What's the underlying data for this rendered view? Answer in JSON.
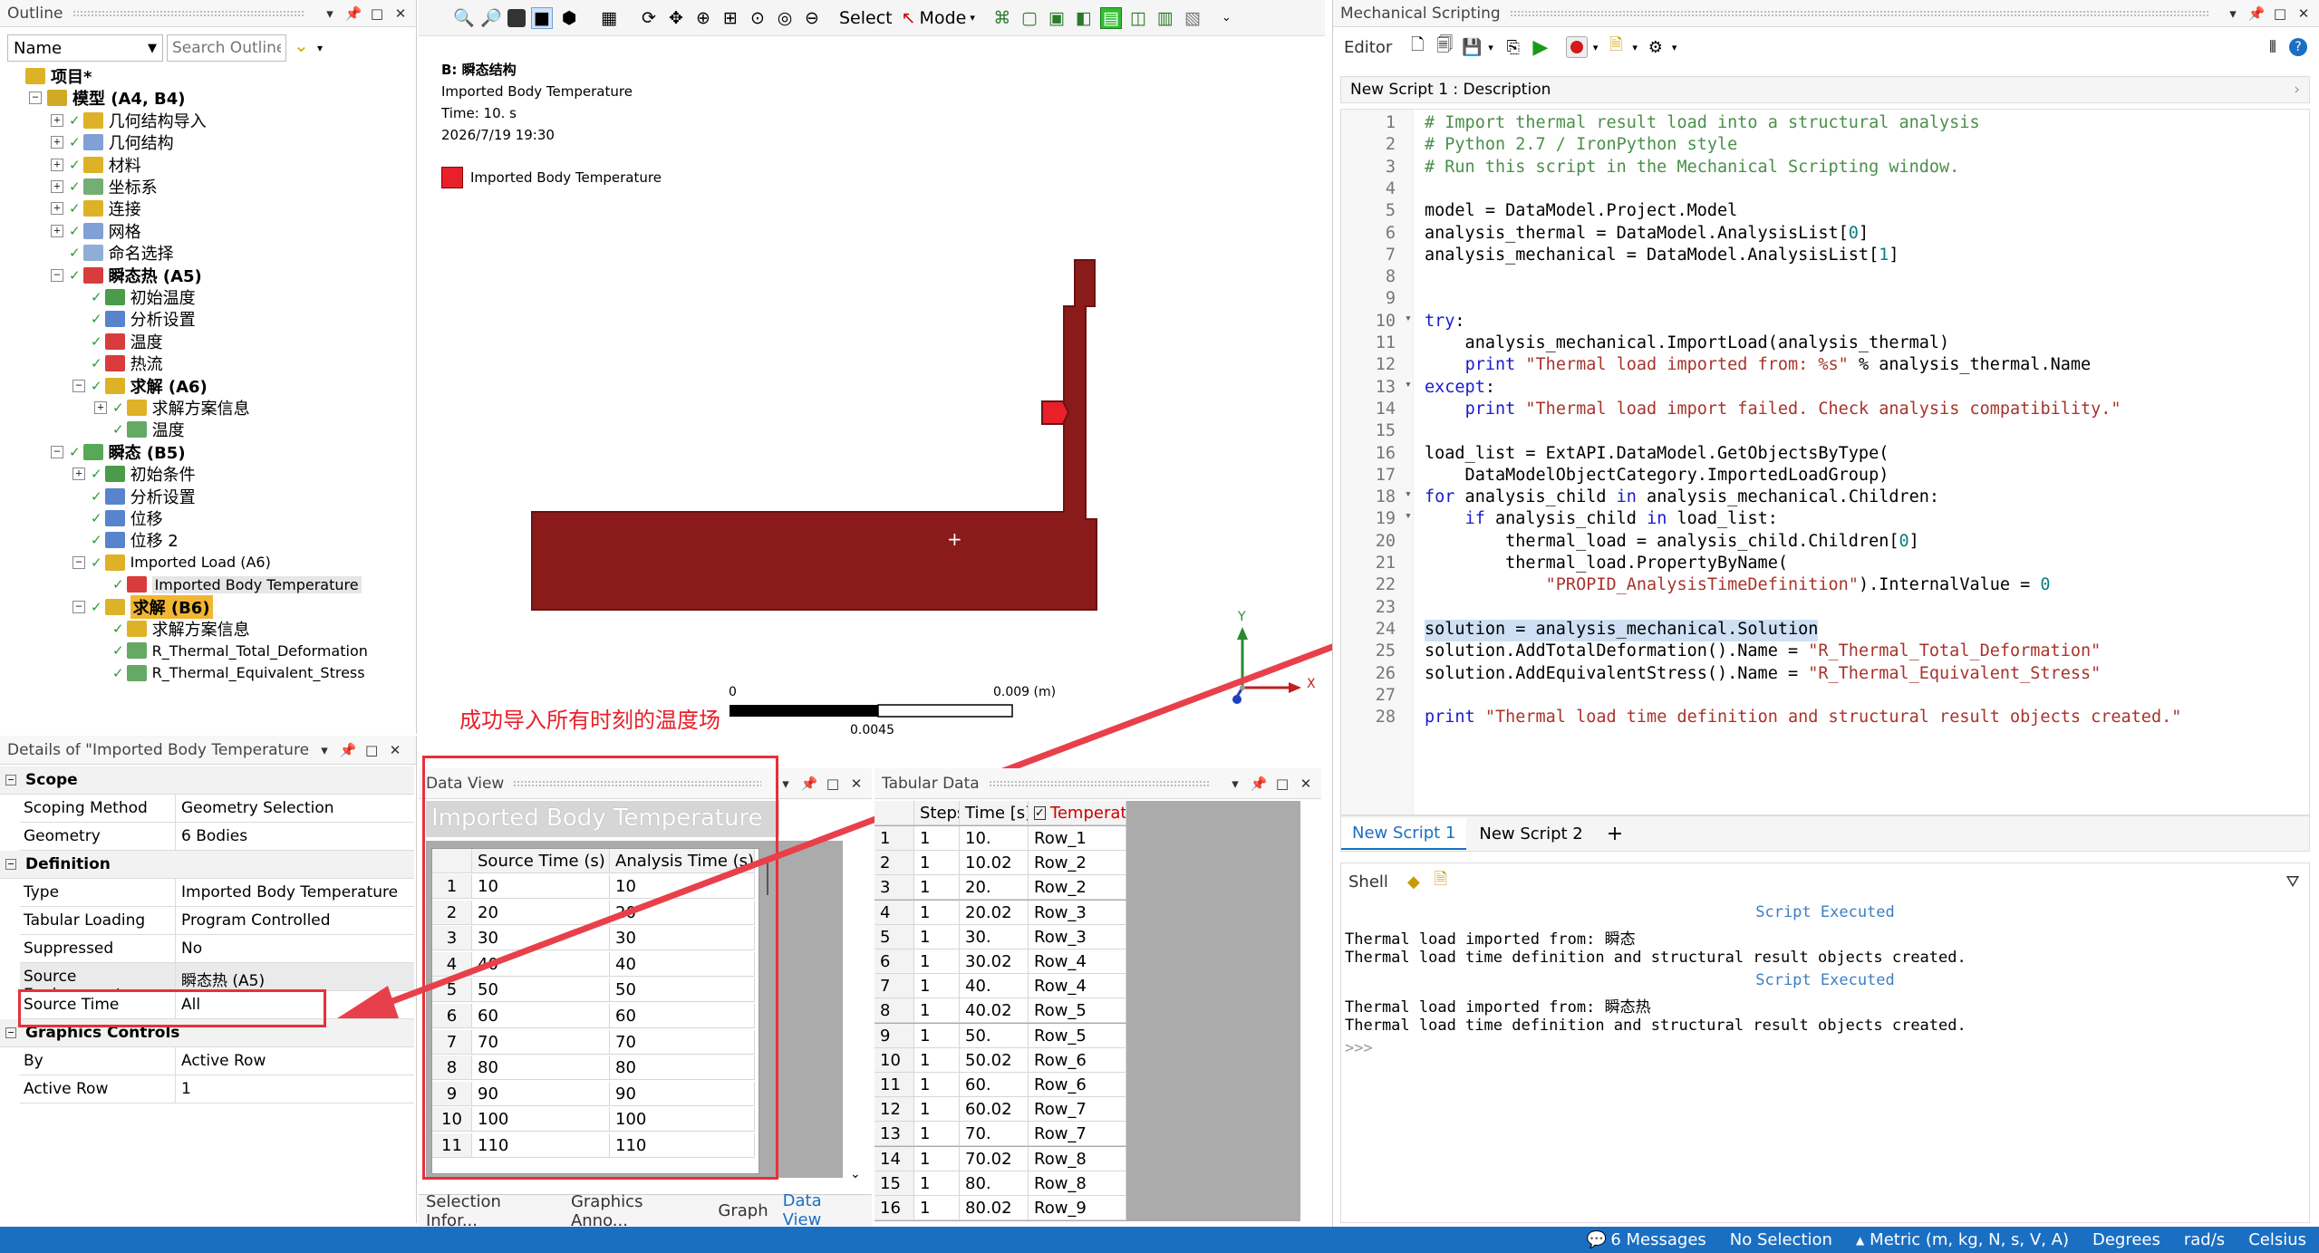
{
  "outline": {
    "title": "Outline",
    "filter_value": "Name",
    "search_placeholder": "Search Outline",
    "tree": [
      {
        "label": "项目*",
        "level": 0,
        "bold": true,
        "exp": "",
        "icon": "project"
      },
      {
        "label": "模型 (A4, B4)",
        "level": 1,
        "bold": true,
        "exp": "−",
        "icon": "model"
      },
      {
        "label": "几何结构导入",
        "level": 2,
        "exp": "+",
        "icon": "folder"
      },
      {
        "label": "几何结构",
        "level": 2,
        "exp": "+",
        "icon": "geom"
      },
      {
        "label": "材料",
        "level": 2,
        "exp": "+",
        "icon": "folder"
      },
      {
        "label": "坐标系",
        "level": 2,
        "exp": "+",
        "icon": "coord"
      },
      {
        "label": "连接",
        "level": 2,
        "exp": "+",
        "icon": "folder"
      },
      {
        "label": "网格",
        "level": 2,
        "exp": "+",
        "icon": "mesh"
      },
      {
        "label": "命名选择",
        "level": 2,
        "exp": "",
        "icon": "named"
      },
      {
        "label": "瞬态热 (A5)",
        "level": 2,
        "bold": true,
        "exp": "−",
        "icon": "thermal"
      },
      {
        "label": "初始温度",
        "level": 3,
        "exp": "",
        "icon": "init"
      },
      {
        "label": "分析设置",
        "level": 3,
        "exp": "",
        "icon": "settings"
      },
      {
        "label": "温度",
        "level": 3,
        "exp": "",
        "icon": "temp"
      },
      {
        "label": "热流",
        "level": 3,
        "exp": "",
        "icon": "flux"
      },
      {
        "label": "求解 (A6)",
        "level": 3,
        "bold": true,
        "exp": "−",
        "icon": "solution"
      },
      {
        "label": "求解方案信息",
        "level": 4,
        "exp": "+",
        "icon": "info"
      },
      {
        "label": "温度",
        "level": 4,
        "exp": "",
        "icon": "result"
      },
      {
        "label": "瞬态 (B5)",
        "level": 2,
        "bold": true,
        "exp": "−",
        "icon": "structural"
      },
      {
        "label": "初始条件",
        "level": 3,
        "exp": "+",
        "icon": "init"
      },
      {
        "label": "分析设置",
        "level": 3,
        "exp": "",
        "icon": "settings"
      },
      {
        "label": "位移",
        "level": 3,
        "exp": "",
        "icon": "disp"
      },
      {
        "label": "位移 2",
        "level": 3,
        "exp": "",
        "icon": "disp"
      },
      {
        "label": "Imported Load (A6)",
        "level": 3,
        "exp": "−",
        "icon": "folder"
      },
      {
        "label": "Imported Body Temperature",
        "level": 4,
        "exp": "",
        "icon": "ibt",
        "selected": true
      },
      {
        "label": "求解 (B6)",
        "level": 3,
        "bold": true,
        "exp": "−",
        "icon": "solution",
        "highlight": true
      },
      {
        "label": "求解方案信息",
        "level": 4,
        "exp": "",
        "icon": "info"
      },
      {
        "label": "R_Thermal_Total_Deformation",
        "level": 4,
        "exp": "",
        "icon": "result"
      },
      {
        "label": "R_Thermal_Equivalent_Stress",
        "level": 4,
        "exp": "",
        "icon": "result"
      }
    ]
  },
  "details": {
    "title": "Details of \"Imported Body Temperature",
    "sections": [
      {
        "name": "Scope",
        "rows": [
          [
            "Scoping Method",
            "Geometry Selection"
          ],
          [
            "Geometry",
            "6 Bodies"
          ]
        ]
      },
      {
        "name": "Definition",
        "rows": [
          [
            "Type",
            "Imported Body Temperature"
          ],
          [
            "Tabular Loading",
            "Program Controlled"
          ],
          [
            "Suppressed",
            "No"
          ],
          [
            "Source Environment",
            "瞬态热 (A5)"
          ],
          [
            "Source Time",
            "All"
          ]
        ]
      },
      {
        "name": "Graphics Controls",
        "rows": [
          [
            "By",
            "Active Row"
          ],
          [
            "Active Row",
            "1"
          ]
        ]
      }
    ]
  },
  "toolbar": {
    "select_label": "Select",
    "mode_label": "Mode"
  },
  "graphics": {
    "header_title": "B: 瞬态结构",
    "header_sub": "Imported Body Temperature",
    "header_time": "Time: 10. s",
    "header_date": "2026/7/19 19:30",
    "legend_label": "Imported Body Temperature",
    "legend_color": "#e8202a",
    "body_color": "#8b1a1a",
    "scale_left": "0",
    "scale_right": "0.009 (m)",
    "scale_mid": "0.0045",
    "axis_y": "Y",
    "axis_x": "X",
    "annotation": "成功导入所有时刻的温度场"
  },
  "data_view": {
    "title": "Data View",
    "header": "Imported Body Temperature",
    "col1": "Source Time (s)",
    "col2": "Analysis Time (s)",
    "rows": [
      [
        "1",
        "10",
        "10"
      ],
      [
        "2",
        "20",
        "20"
      ],
      [
        "3",
        "30",
        "30"
      ],
      [
        "4",
        "40",
        "40"
      ],
      [
        "5",
        "50",
        "50"
      ],
      [
        "6",
        "60",
        "60"
      ],
      [
        "7",
        "70",
        "70"
      ],
      [
        "8",
        "80",
        "80"
      ],
      [
        "9",
        "90",
        "90"
      ],
      [
        "10",
        "100",
        "100"
      ],
      [
        "11",
        "110",
        "110"
      ]
    ]
  },
  "tabular": {
    "title": "Tabular Data",
    "cols": [
      "Steps",
      "Time [s]",
      "Temperature"
    ],
    "rows": [
      [
        "1",
        "1",
        "10.",
        "Row_1"
      ],
      [
        "2",
        "1",
        "10.02",
        "Row_2"
      ],
      [
        "3",
        "1",
        "20.",
        "Row_2"
      ],
      [
        "4",
        "1",
        "20.02",
        "Row_3"
      ],
      [
        "5",
        "1",
        "30.",
        "Row_3"
      ],
      [
        "6",
        "1",
        "30.02",
        "Row_4"
      ],
      [
        "7",
        "1",
        "40.",
        "Row_4"
      ],
      [
        "8",
        "1",
        "40.02",
        "Row_5"
      ],
      [
        "9",
        "1",
        "50.",
        "Row_5"
      ],
      [
        "10",
        "1",
        "50.02",
        "Row_6"
      ],
      [
        "11",
        "1",
        "60.",
        "Row_6"
      ],
      [
        "12",
        "1",
        "60.02",
        "Row_7"
      ],
      [
        "13",
        "1",
        "70.",
        "Row_7"
      ],
      [
        "14",
        "1",
        "70.02",
        "Row_8"
      ],
      [
        "15",
        "1",
        "80.",
        "Row_8"
      ],
      [
        "16",
        "1",
        "80.02",
        "Row_9"
      ]
    ]
  },
  "bottom_tabs": [
    "Selection Infor...",
    "Graphics Anno...",
    "Graph",
    "Data View"
  ],
  "scripting": {
    "title": "Mechanical Scripting",
    "editor_label": "Editor",
    "description": "New Script 1 : Description",
    "tabs": [
      "New Script 1",
      "New Script 2"
    ],
    "add_tab": "+",
    "shell_label": "Shell",
    "code": [
      [
        [
          "cm",
          "# Import thermal result load into a structural analysis"
        ]
      ],
      [
        [
          "cm",
          "# Python 2.7 / IronPython style"
        ]
      ],
      [
        [
          "cm",
          "# Run this script in the Mechanical Scripting window."
        ]
      ],
      [],
      [
        [
          "pl",
          "model = DataModel.Project.Model"
        ]
      ],
      [
        [
          "pl",
          "analysis_thermal = DataModel.AnalysisList["
        ],
        [
          "nm",
          "0"
        ],
        [
          "pl",
          "]"
        ]
      ],
      [
        [
          "pl",
          "analysis_mechanical = DataModel.AnalysisList["
        ],
        [
          "nm",
          "1"
        ],
        [
          "pl",
          "]"
        ]
      ],
      [],
      [],
      [
        [
          "kw",
          "try"
        ],
        [
          "pl",
          ":"
        ]
      ],
      [
        [
          "pl",
          "    analysis_mechanical.ImportLoad(analysis_thermal)"
        ]
      ],
      [
        [
          "pl",
          "    "
        ],
        [
          "kw",
          "print"
        ],
        [
          "pl",
          " "
        ],
        [
          "st",
          "\"Thermal load imported from: %s\""
        ],
        [
          "pl",
          " % analysis_thermal.Name"
        ]
      ],
      [
        [
          "kw",
          "except"
        ],
        [
          "pl",
          ":"
        ]
      ],
      [
        [
          "pl",
          "    "
        ],
        [
          "kw",
          "print"
        ],
        [
          "pl",
          " "
        ],
        [
          "st",
          "\"Thermal load import failed. Check analysis compatibility.\""
        ]
      ],
      [],
      [
        [
          "pl",
          "load_list = ExtAPI.DataModel.GetObjectsByType("
        ]
      ],
      [
        [
          "pl",
          "    DataModelObjectCategory.ImportedLoadGroup)"
        ]
      ],
      [
        [
          "kw",
          "for"
        ],
        [
          "pl",
          " analysis_child "
        ],
        [
          "kw",
          "in"
        ],
        [
          "pl",
          " analysis_mechanical.Children:"
        ]
      ],
      [
        [
          "pl",
          "    "
        ],
        [
          "kw",
          "if"
        ],
        [
          "pl",
          " analysis_child "
        ],
        [
          "kw",
          "in"
        ],
        [
          "pl",
          " load_list:"
        ]
      ],
      [
        [
          "pl",
          "        thermal_load = analysis_child.Children["
        ],
        [
          "nm",
          "0"
        ],
        [
          "pl",
          "]"
        ]
      ],
      [
        [
          "pl",
          "        thermal_load.PropertyByName("
        ]
      ],
      [
        [
          "pl",
          "            "
        ],
        [
          "st",
          "\"PROPID_AnalysisTimeDefinition\""
        ],
        [
          "pl",
          ").InternalValue = "
        ],
        [
          "nm",
          "0"
        ]
      ],
      [],
      [
        [
          "pl",
          "solution = analysis_mechanical.Solution"
        ]
      ],
      [
        [
          "pl",
          "solution.AddTotalDeformation().Name = "
        ],
        [
          "st",
          "\"R_Thermal_Total_Deformation\""
        ]
      ],
      [
        [
          "pl",
          "solution.AddEquivalentStress().Name = "
        ],
        [
          "st",
          "\"R_Thermal_Equivalent_Stress\""
        ]
      ],
      [],
      [
        [
          "kw",
          "print"
        ],
        [
          "pl",
          " "
        ],
        [
          "st",
          "\"Thermal load time definition and structural result objects created.\""
        ]
      ]
    ],
    "shell": [
      {
        "t": "Script Executed",
        "c": "center"
      },
      {
        "t": "Thermal load imported from: 瞬态",
        "c": "out"
      },
      {
        "t": "Thermal load time definition and structural result objects created.",
        "c": "out"
      },
      {
        "t": "Script Executed",
        "c": "center"
      },
      {
        "t": "Thermal load imported from: 瞬态热",
        "c": "out"
      },
      {
        "t": "Thermal load time definition and structural result objects created.",
        "c": "out"
      },
      {
        "t": ">>>",
        "c": "prompt"
      }
    ]
  },
  "status": {
    "messages": "6 Messages",
    "selection": "No Selection",
    "units": "Metric (m, kg, N, s, V, A)",
    "angle": "Degrees",
    "rot": "rad/s",
    "temp": "Celsius"
  }
}
